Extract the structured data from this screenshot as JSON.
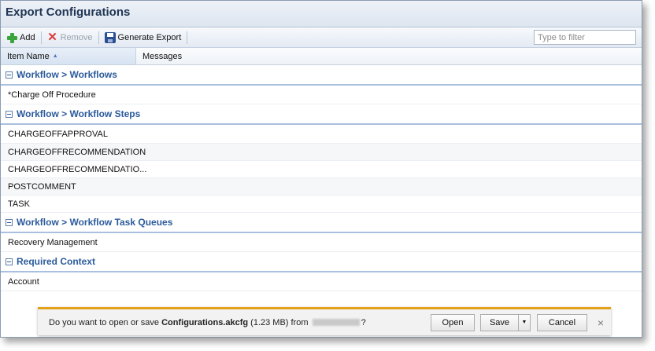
{
  "window": {
    "title": "Export Configurations"
  },
  "toolbar": {
    "add_label": "Add",
    "remove_label": "Remove",
    "generate_label": "Generate Export",
    "filter_placeholder": "Type to filter"
  },
  "columns": {
    "item_name": "Item Name",
    "messages": "Messages"
  },
  "groups": [
    {
      "title": "Workflow > Workflows",
      "rows": [
        "*Charge Off Procedure"
      ]
    },
    {
      "title": "Workflow > Workflow Steps",
      "rows": [
        "CHARGEOFFAPPROVAL",
        "CHARGEOFFRECOMMENDATION",
        "CHARGEOFFRECOMMENDATIO...",
        "POSTCOMMENT",
        "TASK"
      ]
    },
    {
      "title": "Workflow > Workflow Task Queues",
      "rows": [
        "Recovery Management"
      ]
    },
    {
      "title": "Required Context",
      "rows": [
        "Account"
      ]
    }
  ],
  "download_bar": {
    "prefix": "Do you want to open or save",
    "filename": "Configurations.akcfg",
    "size": "(1.23 MB)",
    "from": "from",
    "suffix": "?",
    "open": "Open",
    "save": "Save",
    "cancel": "Cancel",
    "close": "×"
  },
  "colors": {
    "accent": "#2b5a9c",
    "download_bar_accent": "#e3a21a"
  }
}
